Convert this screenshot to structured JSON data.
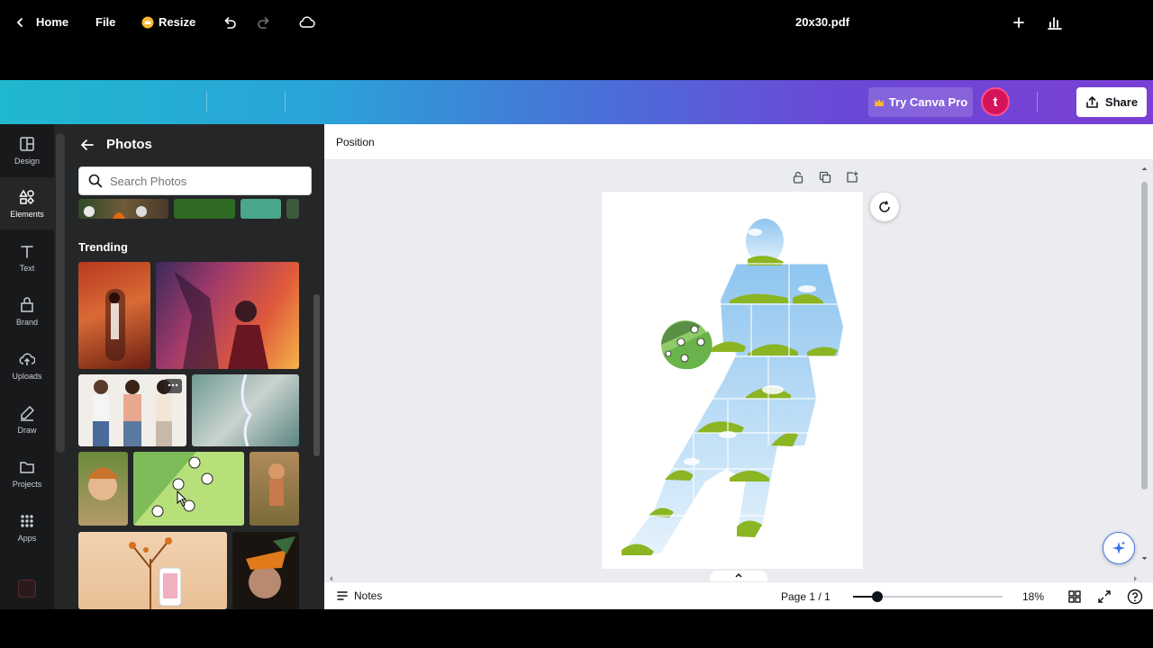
{
  "header": {
    "home_label": "Home",
    "file_label": "File",
    "resize_label": "Resize",
    "doc_title": "20x30.pdf",
    "try_pro_label": "Try Canva Pro",
    "avatar_initial": "t",
    "share_label": "Share"
  },
  "rail": {
    "items": [
      {
        "label": "Design"
      },
      {
        "label": "Elements"
      },
      {
        "label": "Text"
      },
      {
        "label": "Brand"
      },
      {
        "label": "Uploads"
      },
      {
        "label": "Draw"
      },
      {
        "label": "Projects"
      },
      {
        "label": "Apps"
      }
    ]
  },
  "panel": {
    "title": "Photos",
    "search_placeholder": "Search Photos",
    "section_title": "Trending"
  },
  "canvas": {
    "toolbar_label": "Position"
  },
  "bottombar": {
    "notes_label": "Notes",
    "page_indicator": "Page 1 / 1",
    "zoom_label": "18%",
    "zoom_fraction": 0.16
  },
  "colors": {
    "gradient_start": "#1fb8cf",
    "gradient_end": "#7a3fd4",
    "avatar": "#d4145a",
    "rail_bg": "#18191b",
    "panel_bg": "#252627",
    "workspace_bg": "#ebecf0"
  }
}
